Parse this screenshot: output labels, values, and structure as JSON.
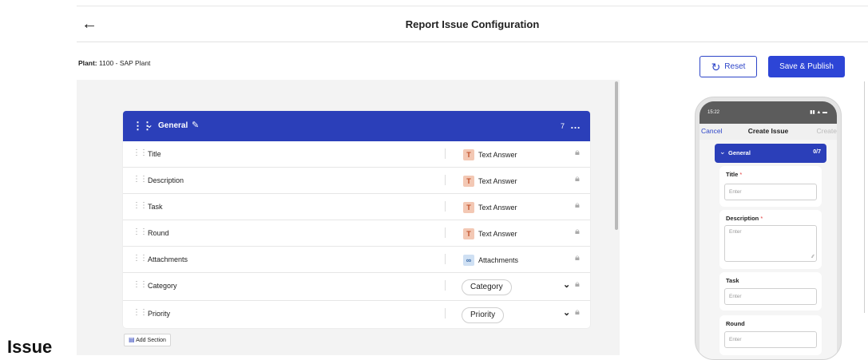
{
  "header": {
    "back_icon": "arrow-left-icon",
    "title": "Report Issue Configuration"
  },
  "plant": {
    "label": "Plant:",
    "value": "1100 - SAP Plant"
  },
  "actions": {
    "reset_label": "Reset",
    "reset_icon": "refresh-icon",
    "publish_label": "Save & Publish"
  },
  "section": {
    "title": "General",
    "count": "7",
    "fields": [
      {
        "name": "Title",
        "type": "Text Answer",
        "type_icon": "T"
      },
      {
        "name": "Description",
        "type": "Text Answer",
        "type_icon": "T"
      },
      {
        "name": "Task",
        "type": "Text Answer",
        "type_icon": "T"
      },
      {
        "name": "Round",
        "type": "Text Answer",
        "type_icon": "T"
      },
      {
        "name": "Attachments",
        "type": "Attachments",
        "type_icon": "paperclip"
      },
      {
        "name": "Category",
        "dropdown": "Category"
      },
      {
        "name": "Priority",
        "dropdown": "Priority"
      }
    ]
  },
  "add_section_label": "Add Section",
  "left_label": "Issue",
  "preview": {
    "time": "15:22",
    "status_icons": "signal-wifi-battery",
    "cancel": "Cancel",
    "title": "Create Issue",
    "create": "Create",
    "section_title": "General",
    "section_count": "0/7",
    "fields": [
      {
        "label": "Title",
        "required": "*",
        "placeholder": "Enter"
      },
      {
        "label": "Description",
        "required": "*",
        "placeholder": "Enter"
      },
      {
        "label": "Task",
        "required": "",
        "placeholder": "Enter"
      },
      {
        "label": "Round",
        "required": "",
        "placeholder": "Enter"
      }
    ]
  },
  "colors": {
    "primary": "#2b3fb9",
    "button": "#2d45d6",
    "required": "#e23b3b"
  }
}
